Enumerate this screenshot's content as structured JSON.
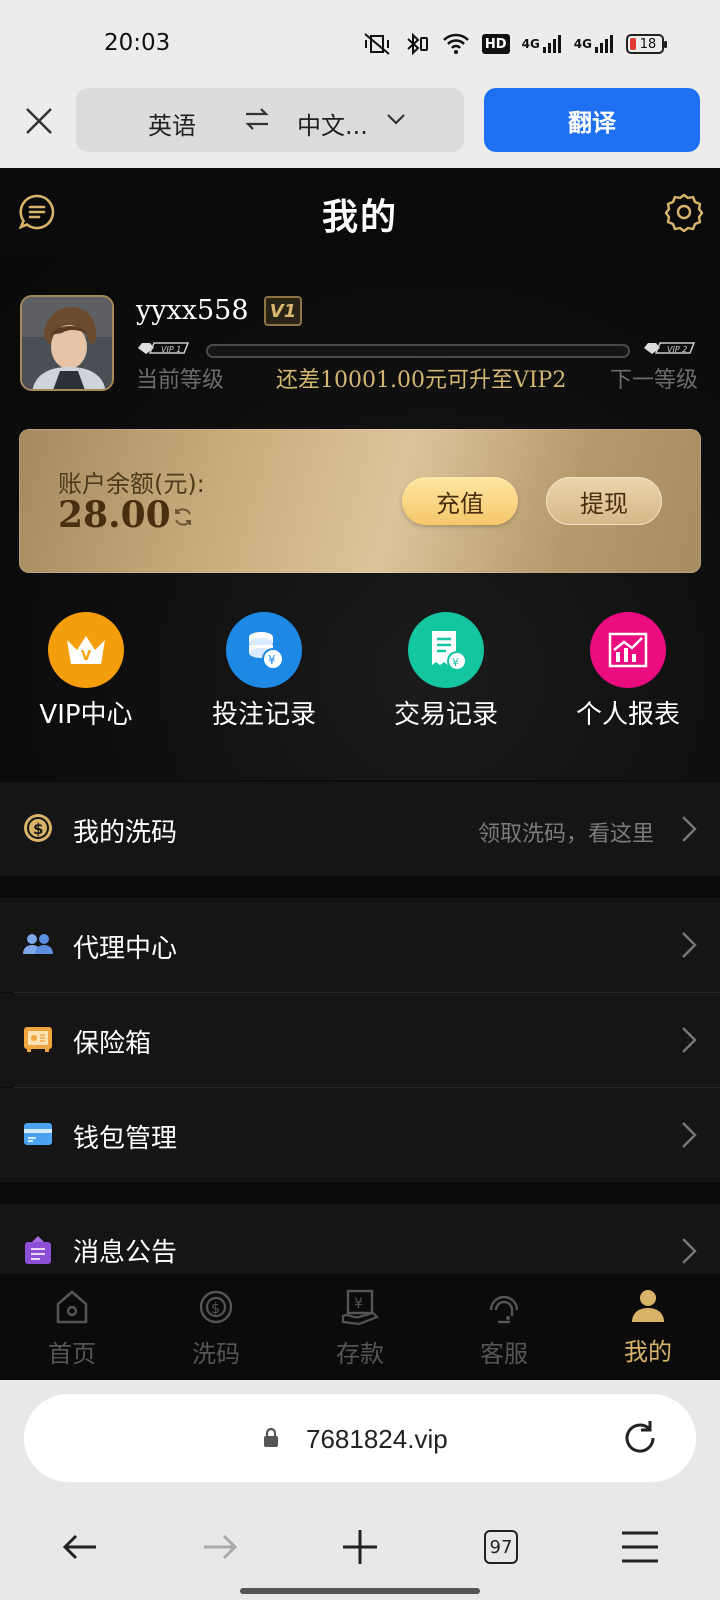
{
  "status_bar": {
    "time": "20:03",
    "battery": "18",
    "net1": "4G",
    "net2": "4G",
    "hd": "HD"
  },
  "translate_bar": {
    "from_lang": "英语",
    "to_lang": "中文...",
    "translate_label": "翻译"
  },
  "header": {
    "title": "我的"
  },
  "profile": {
    "username": "yyxx558",
    "vip_badge": "V1",
    "current_tag": "VIP 1",
    "next_tag": "VIP 2",
    "current_level_label": "当前等级",
    "upgrade_hint": "还差10001.00元可升至VIP2",
    "next_level_label": "下一等级",
    "progress": 0.0
  },
  "balance": {
    "label": "账户余额(元):",
    "amount": "28.00",
    "recharge_label": "充值",
    "withdraw_label": "提现"
  },
  "quick_actions": [
    {
      "label": "VIP中心",
      "icon": "crown-icon",
      "color": "#f59e0b"
    },
    {
      "label": "投注记录",
      "icon": "coins-icon",
      "color": "#1e88e5"
    },
    {
      "label": "交易记录",
      "icon": "receipt-icon",
      "color": "#14c6a0"
    },
    {
      "label": "个人报表",
      "icon": "chart-icon",
      "color": "#ec0c82"
    }
  ],
  "menu": {
    "rebate": {
      "label": "我的洗码",
      "hint": "领取洗码，看这里"
    },
    "agent": {
      "label": "代理中心"
    },
    "safe": {
      "label": "保险箱"
    },
    "wallet": {
      "label": "钱包管理"
    },
    "notice": {
      "label": "消息公告"
    }
  },
  "tabbar": [
    {
      "label": "首页",
      "icon": "home-icon",
      "active": false
    },
    {
      "label": "洗码",
      "icon": "dollar-target-icon",
      "active": false
    },
    {
      "label": "存款",
      "icon": "deposit-icon",
      "active": false
    },
    {
      "label": "客服",
      "icon": "support-icon",
      "active": false
    },
    {
      "label": "我的",
      "icon": "user-icon",
      "active": true
    }
  ],
  "browser": {
    "url": "7681824.vip",
    "tab_count": "97"
  },
  "colors": {
    "accent_gold": "#d8b46a",
    "translate_blue": "#1f6ff2"
  }
}
